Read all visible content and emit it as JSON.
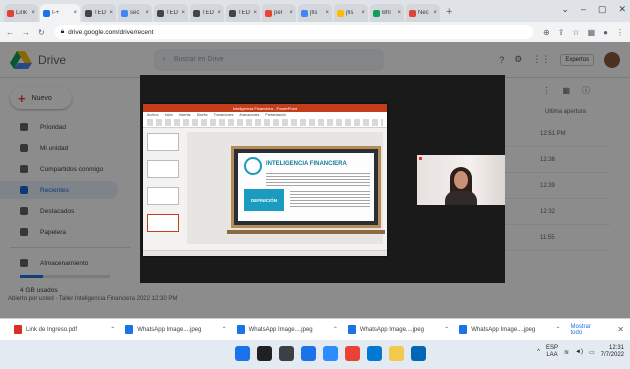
{
  "browser": {
    "tabs": [
      {
        "label": "Lirik",
        "color": "#db4437"
      },
      {
        "label": "I-+ ",
        "color": "#1a73e8"
      },
      {
        "label": "TED",
        "color": "#444444"
      },
      {
        "label": "sec",
        "color": "#4285f4"
      },
      {
        "label": "TED",
        "color": "#444444"
      },
      {
        "label": "TED",
        "color": "#444444"
      },
      {
        "label": "TED",
        "color": "#444444"
      },
      {
        "label": "per",
        "color": "#ea4335"
      },
      {
        "label": "jfis",
        "color": "#4285f4"
      },
      {
        "label": "jfis",
        "color": "#fbbc04"
      },
      {
        "label": "Bhl",
        "color": "#0f9d58"
      },
      {
        "label": "Nec",
        "color": "#db4437"
      }
    ],
    "new_tab": "+",
    "url": "drive.google.com/drive/recent"
  },
  "drive": {
    "title": "Drive",
    "search_placeholder": "Buscar en Drive",
    "new_label": "Nuevo",
    "org_chip": "Expertos",
    "sidebar": [
      {
        "label": "Prioridad",
        "selected": false
      },
      {
        "label": "Mi unidad",
        "selected": false
      },
      {
        "label": "Compartidos conmigo",
        "selected": false
      },
      {
        "label": "Recientes",
        "selected": true
      },
      {
        "label": "Destacados",
        "selected": false
      },
      {
        "label": "Papelera",
        "selected": false
      }
    ],
    "storage_label": "Almacenamiento",
    "storage_used": "4 GB usados",
    "storage_fraction": 0.25,
    "column_header": "Ultima apertura",
    "rows": [
      {
        "date": "12:51 PM"
      },
      {
        "date": "12:36"
      },
      {
        "date": "12:39"
      },
      {
        "date": "12:32"
      },
      {
        "date": "11:55"
      }
    ],
    "last_row": "Abierto por usted · Taller Inteligencia Financiera 2022 12:30 PM"
  },
  "slide": {
    "window_title": "Inteligencia Financiera - PowerPoint",
    "ribbon_tabs": [
      "Archivo",
      "Inicio",
      "Insertar",
      "Diseño",
      "Transiciones",
      "Animaciones",
      "Presentación"
    ],
    "heading": "INTELIGENCIA FINANCIERA",
    "definition_label": "DEFINICIÓN"
  },
  "downloads": [
    {
      "name": "Link de Ingreso.pdf",
      "color": "#d93025"
    },
    {
      "name": "WhatsApp Image....jpeg",
      "color": "#1a73e8"
    },
    {
      "name": "WhatsApp Image....jpeg",
      "color": "#1a73e8"
    },
    {
      "name": "WhatsApp Image....jpeg",
      "color": "#1a73e8"
    },
    {
      "name": "WhatsApp Image....jpeg",
      "color": "#1a73e8"
    }
  ],
  "downloads_show_all": "Mostrar todo",
  "taskbar": {
    "icons": [
      {
        "name": "windows-start-icon",
        "color": "#1a73e8"
      },
      {
        "name": "search-icon",
        "color": "#202124"
      },
      {
        "name": "task-view-icon",
        "color": "#3c4043"
      },
      {
        "name": "widgets-icon",
        "color": "#1a73e8"
      },
      {
        "name": "zoom-icon",
        "color": "#2d8cff"
      },
      {
        "name": "chrome-icon",
        "color": "#ea4335"
      },
      {
        "name": "mail-icon",
        "color": "#0078d4"
      },
      {
        "name": "file-explorer-icon",
        "color": "#f2c94c"
      },
      {
        "name": "store-icon",
        "color": "#0067b8"
      }
    ],
    "lang_top": "ESP",
    "lang_bottom": "LAA",
    "time": "12:31",
    "date": "7/7/2022"
  }
}
